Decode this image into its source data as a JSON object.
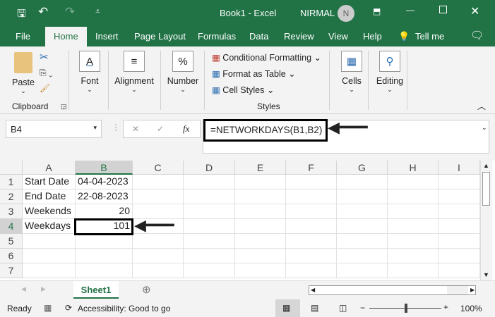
{
  "title_bar": {
    "title": "Book1  -  Excel",
    "user": "NIRMAL",
    "avatar": "N"
  },
  "tabs": [
    "File",
    "Home",
    "Insert",
    "Page Layout",
    "Formulas",
    "Data",
    "Review",
    "View",
    "Help",
    "Tell me"
  ],
  "ribbon": {
    "paste": "Paste",
    "clipboard": "Clipboard",
    "font": "Font",
    "alignment": "Alignment",
    "number": "Number",
    "conditional_formatting": "Conditional Formatting",
    "format_as_table": "Format as Table",
    "cell_styles": "Cell Styles",
    "styles": "Styles",
    "cells": "Cells",
    "editing": "Editing"
  },
  "formula_bar": {
    "name_box": "B4",
    "formula": "=NETWORKDAYS(B1,B2)",
    "fx": "fx"
  },
  "columns": [
    "A",
    "B",
    "C",
    "D",
    "E",
    "F",
    "G",
    "H",
    "I"
  ],
  "rows": [
    {
      "n": "1",
      "a": "Start Date",
      "b": "04-04-2023"
    },
    {
      "n": "2",
      "a": "End Date",
      "b": "22-08-2023"
    },
    {
      "n": "3",
      "a": "Weekends",
      "b": "20"
    },
    {
      "n": "4",
      "a": "Weekdays",
      "b": "101"
    },
    {
      "n": "5",
      "a": "",
      "b": ""
    },
    {
      "n": "6",
      "a": "",
      "b": ""
    },
    {
      "n": "7",
      "a": "",
      "b": ""
    }
  ],
  "sheet_tab": "Sheet1",
  "status": {
    "ready": "Ready",
    "accessibility": "Accessibility: Good to go",
    "zoom": "100%"
  }
}
